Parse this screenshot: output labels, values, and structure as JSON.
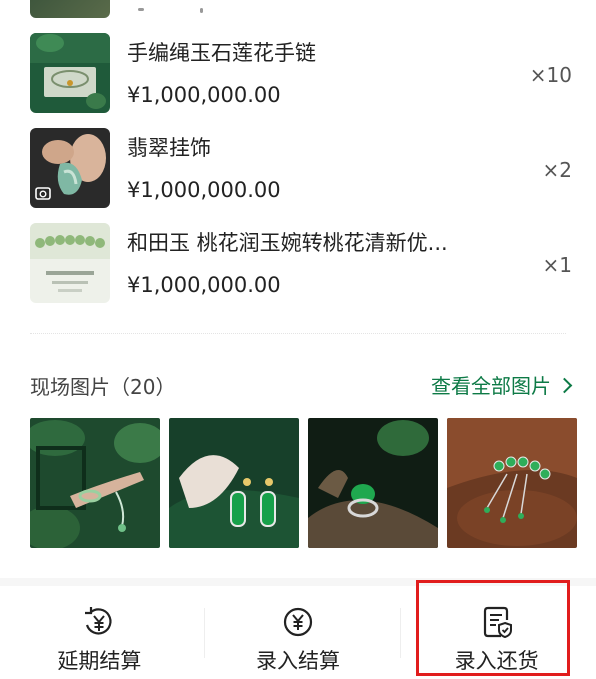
{
  "products": [
    {
      "name": "手编绳玉石莲花手链",
      "price": "¥1,000,000.00",
      "qty": "×10"
    },
    {
      "name": "翡翠挂饰",
      "price": "¥1,000,000.00",
      "qty": "×2"
    },
    {
      "name": "和田玉 桃花润玉婉转桃花清新优...",
      "price": "¥1,000,000.00",
      "qty": "×1"
    }
  ],
  "site_photos": {
    "title": "现场图片（20）",
    "view_all": "查看全部图片"
  },
  "bottom_actions": [
    {
      "label": "延期结算",
      "icon": "yen-refresh-icon"
    },
    {
      "label": "录入结算",
      "icon": "yen-circle-icon"
    },
    {
      "label": "录入还货",
      "icon": "document-shield-icon"
    }
  ],
  "colors": {
    "accent": "#0d7a46",
    "highlight": "#e11d1d"
  }
}
